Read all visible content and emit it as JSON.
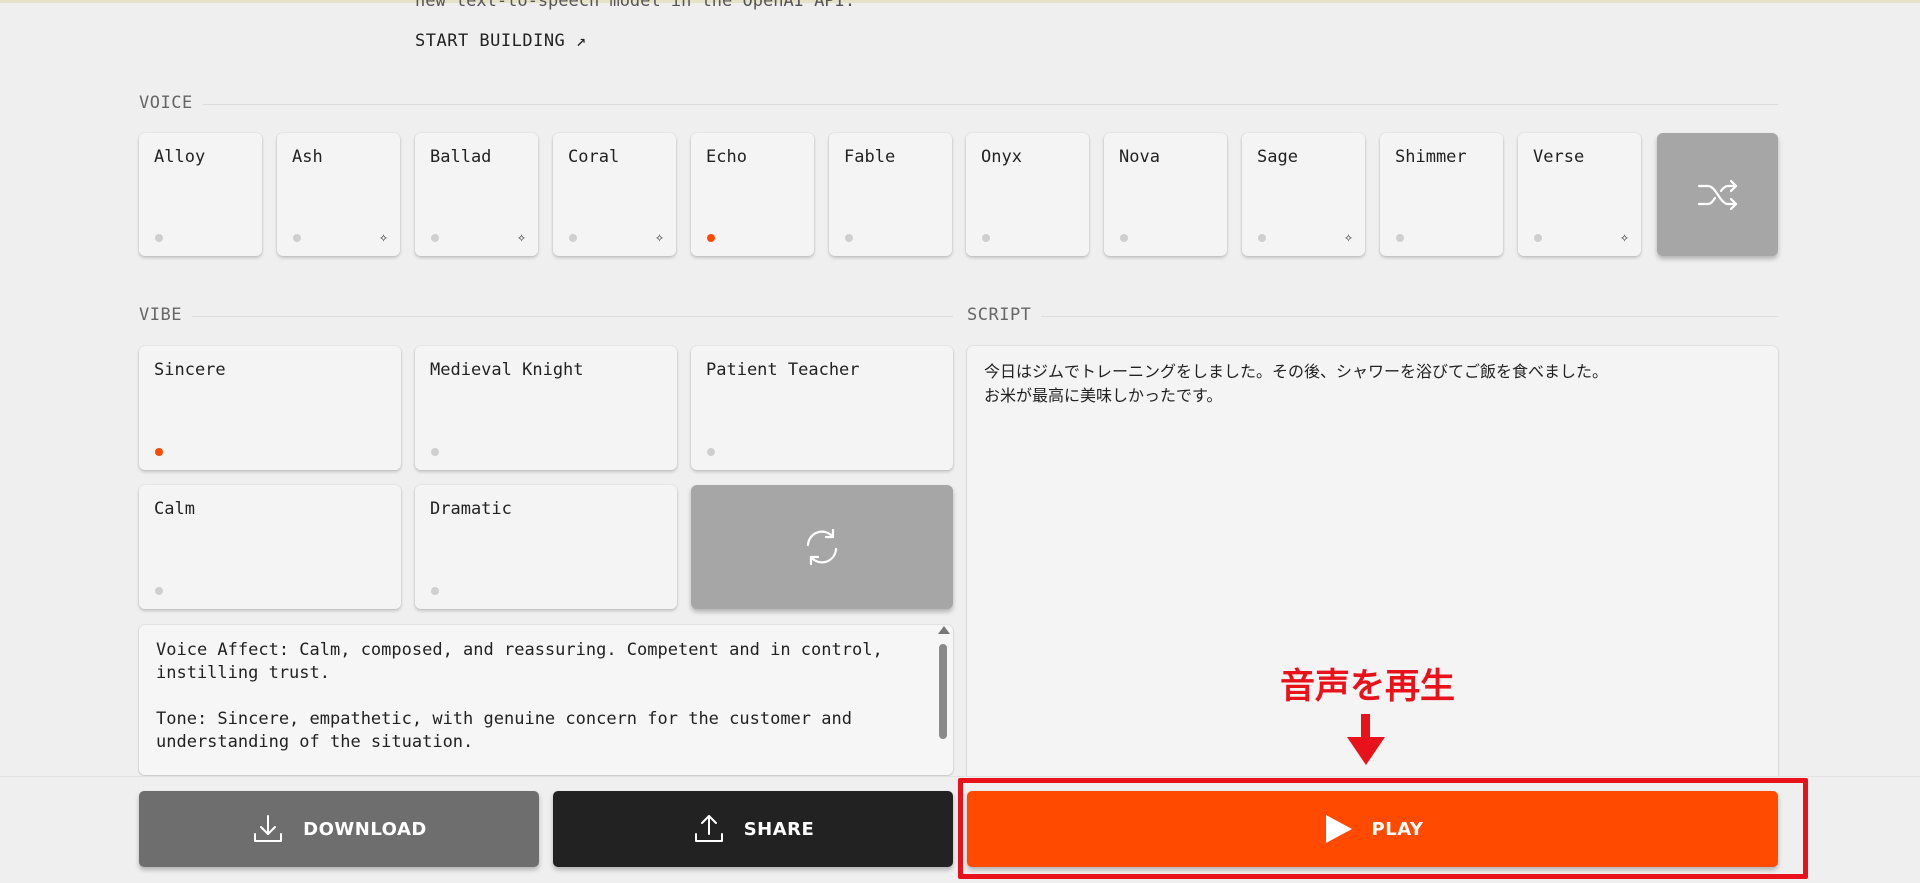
{
  "intro": {
    "text": "new text-to-speech model in the OpenAI API.",
    "start_link": "START BUILDING ↗"
  },
  "voice": {
    "label": "VOICE",
    "selected": "Echo",
    "items": [
      {
        "name": "Alloy",
        "new": false
      },
      {
        "name": "Ash",
        "new": true
      },
      {
        "name": "Ballad",
        "new": true
      },
      {
        "name": "Coral",
        "new": true
      },
      {
        "name": "Echo",
        "new": false
      },
      {
        "name": "Fable",
        "new": false
      },
      {
        "name": "Onyx",
        "new": false
      },
      {
        "name": "Nova",
        "new": false
      },
      {
        "name": "Sage",
        "new": true
      },
      {
        "name": "Shimmer",
        "new": false
      },
      {
        "name": "Verse",
        "new": true
      }
    ],
    "shuffle_icon": "shuffle-icon",
    "new_icon": "sparkle-icon"
  },
  "vibe": {
    "label": "VIBE",
    "selected": "Sincere",
    "items": [
      {
        "name": "Sincere"
      },
      {
        "name": "Medieval Knight"
      },
      {
        "name": "Patient Teacher"
      },
      {
        "name": "Calm"
      },
      {
        "name": "Dramatic"
      }
    ],
    "refresh_icon": "refresh-icon",
    "description": [
      "Voice Affect: Calm, composed, and reassuring. Competent and in control, instilling trust.",
      "Tone: Sincere, empathetic, with genuine concern for the customer and understanding of the situation."
    ]
  },
  "script": {
    "label": "SCRIPT",
    "lines": [
      "今日はジムでトレーニングをしました。その後、シャワーを浴びてご飯を食べました。",
      "お米が最高に美味しかったです。"
    ]
  },
  "annotation": {
    "text": "音声を再生"
  },
  "actions": {
    "download": "DOWNLOAD",
    "share": "SHARE",
    "play": "PLAY"
  },
  "colors": {
    "accent": "#ff4a00",
    "annotation": "#e8121b",
    "card": "#f4f4f4",
    "background": "#efefef"
  }
}
